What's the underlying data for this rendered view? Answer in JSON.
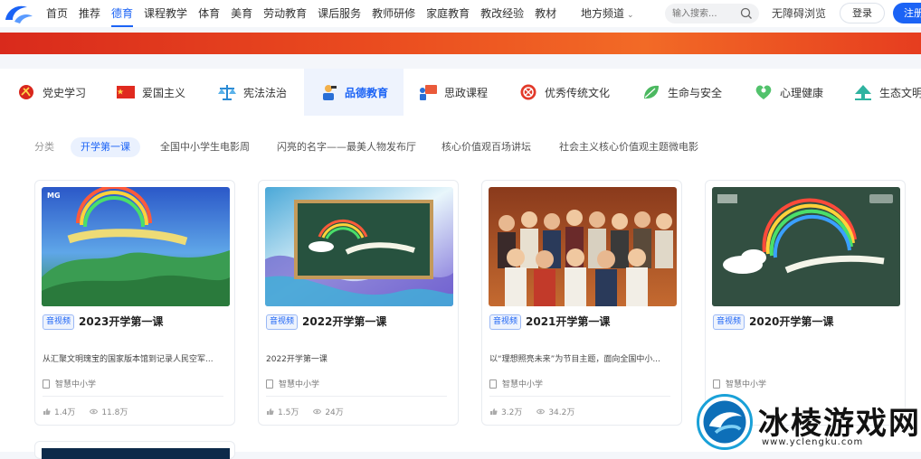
{
  "nav": {
    "items": [
      {
        "label": "首页"
      },
      {
        "label": "推荐"
      },
      {
        "label": "德育"
      },
      {
        "label": "课程教学"
      },
      {
        "label": "体育"
      },
      {
        "label": "美育"
      },
      {
        "label": "劳动教育"
      },
      {
        "label": "课后服务"
      },
      {
        "label": "教师研修"
      },
      {
        "label": "家庭教育"
      },
      {
        "label": "教改经验"
      },
      {
        "label": "教材"
      }
    ],
    "active": "德育",
    "local": "地方频道",
    "search_placeholder": "输入搜索...",
    "accessibility": "无障碍浏览",
    "login": "登录",
    "register": "注册"
  },
  "categories": [
    {
      "label": "党史学习",
      "icon": "party-emblem-icon"
    },
    {
      "label": "爱国主义",
      "icon": "flag-icon"
    },
    {
      "label": "宪法法治",
      "icon": "scales-icon"
    },
    {
      "label": "品德教育",
      "icon": "student-icon"
    },
    {
      "label": "思政课程",
      "icon": "lecture-icon"
    },
    {
      "label": "优秀传统文化",
      "icon": "culture-knot-icon"
    },
    {
      "label": "生命与安全",
      "icon": "leaf-icon"
    },
    {
      "label": "心理健康",
      "icon": "heart-icon"
    },
    {
      "label": "生态文明",
      "icon": "eco-icon"
    }
  ],
  "subnav": {
    "label": "分类",
    "items": [
      {
        "label": "开学第一课"
      },
      {
        "label": "全国中小学生电影周"
      },
      {
        "label": "闪亮的名字——最美人物发布厅"
      },
      {
        "label": "核心价值观百场讲坛"
      },
      {
        "label": "社会主义核心价值观主题微电影"
      }
    ]
  },
  "cards": [
    {
      "badge": "音视频",
      "title": "2023开学第一课",
      "desc": "从汇聚文明瑰宝的国家版本馆到记录人民空军...",
      "source": "智慧中小学",
      "likes": "1.4万",
      "views": "11.8万"
    },
    {
      "badge": "音视频",
      "title": "2022开学第一课",
      "desc": "2022开学第一课",
      "source": "智慧中小学",
      "likes": "1.5万",
      "views": "24万"
    },
    {
      "badge": "音视频",
      "title": "2021开学第一课",
      "desc": "以“理想照亮未来”为节目主题，面向全国中小...",
      "source": "智慧中小学",
      "likes": "3.2万",
      "views": "34.2万"
    },
    {
      "badge": "音视频",
      "title": "2020开学第一课",
      "desc": "",
      "source": "智慧中小学",
      "likes": "",
      "views": ""
    }
  ],
  "watermark": {
    "name": "冰棱游戏网",
    "url": "www.yclengku.com"
  },
  "colors": {
    "accent": "#1b63f5",
    "banner": "#e63d1f"
  }
}
